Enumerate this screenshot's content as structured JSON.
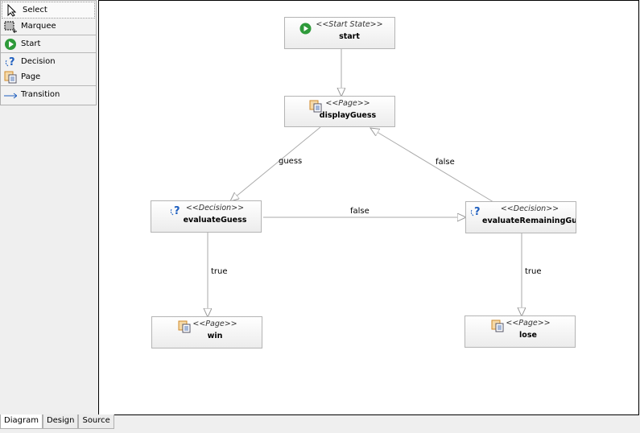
{
  "palette": {
    "items": [
      {
        "label": "Select",
        "icon": "cursor-icon"
      },
      {
        "label": "Marquee",
        "icon": "marquee-icon"
      },
      {
        "label": "Start",
        "icon": "start-state-icon"
      },
      {
        "label": "Decision",
        "icon": "decision-icon"
      },
      {
        "label": "Page",
        "icon": "page-icon"
      },
      {
        "label": "Transition",
        "icon": "transition-arrow-icon"
      }
    ]
  },
  "nodes": {
    "start": {
      "stereotype": "<<Start State>>",
      "name": "start"
    },
    "displayGuess": {
      "stereotype": "<<Page>>",
      "name": "displayGuess"
    },
    "evaluateGuess": {
      "stereotype": "<<Decision>>",
      "name": "evaluateGuess"
    },
    "evaluateRemaining": {
      "stereotype": "<<Decision>>",
      "name": "evaluateRemainingGues"
    },
    "win": {
      "stereotype": "<<Page>>",
      "name": "win"
    },
    "lose": {
      "stereotype": "<<Page>>",
      "name": "lose"
    }
  },
  "transitions": {
    "guess": "guess",
    "false_top": "false",
    "false_mid": "false",
    "true_left": "true",
    "true_right": "true"
  },
  "tabs": [
    "Diagram",
    "Design",
    "Source"
  ],
  "colors": {
    "start_green": "#2e9a3a",
    "transition_blue": "#1f5fbf",
    "page_orange": "#d08a2a"
  }
}
